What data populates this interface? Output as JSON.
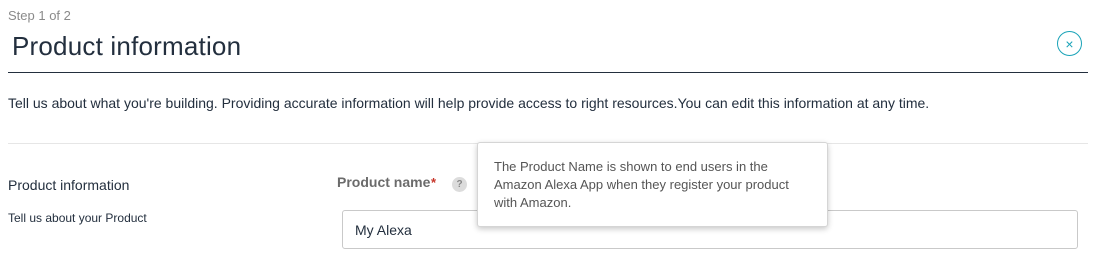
{
  "header": {
    "step": "Step 1 of 2",
    "title": "Product information",
    "close_icon": "×"
  },
  "intro": "Tell us about what you're building. Providing accurate information will help provide access to right resources.You can edit this information at any time.",
  "section": {
    "title": "Product information",
    "subtitle": "Tell us about your Product"
  },
  "field": {
    "label": "Product name",
    "required": "*",
    "help_icon": "?",
    "value": "My Alexa"
  },
  "tooltip": "The Product Name is shown to end users in the Amazon Alexa App when they register your product with Amazon.",
  "colors": {
    "accent": "#1aa3b8",
    "required": "#c7352a",
    "text": "#232f3e"
  }
}
